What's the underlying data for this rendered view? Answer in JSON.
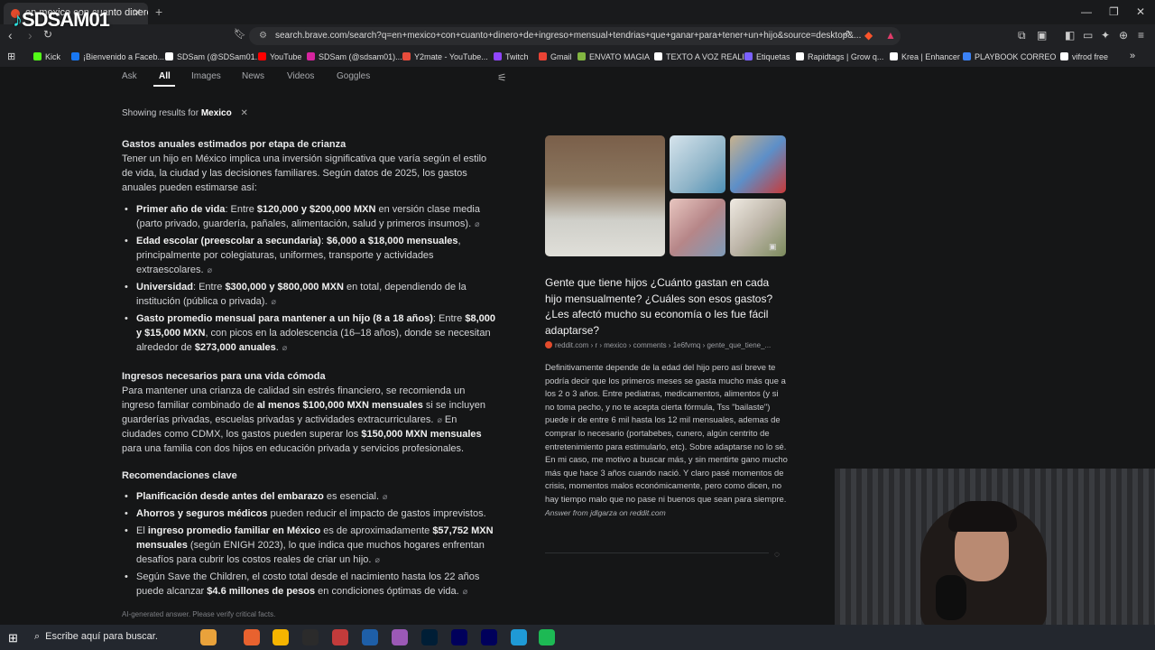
{
  "browser": {
    "tab_title": "en mexico con cuanto dinero de",
    "url": "search.brave.com/search?q=en+mexico+con+cuanto+dinero+de+ingreso+mensual+tendrias+que+ganar+para+tener+un+hijo&source=desktop&...",
    "new_tab": "+",
    "close": "✕"
  },
  "overlay_logo": {
    "text": "SDSAM01",
    "mark": "♪"
  },
  "bookmarks": [
    {
      "label": "Kick",
      "color": "#53fc18"
    },
    {
      "label": "¡Bienvenido a Faceb...",
      "color": "#1877f2"
    },
    {
      "label": "SDSam (@SDSam01...",
      "color": "#ffffff"
    },
    {
      "label": "YouTube",
      "color": "#ff0000"
    },
    {
      "label": "SDSam (@sdsam01)...",
      "color": "#d6249f"
    },
    {
      "label": "Y2mate - YouTube...",
      "color": "#e74c3c"
    },
    {
      "label": "Twitch",
      "color": "#9146ff"
    },
    {
      "label": "Gmail",
      "color": "#ea4335"
    },
    {
      "label": "ENVATO MAGIA",
      "color": "#82b541"
    },
    {
      "label": "TEXTO A VOZ REALI...",
      "color": "#ffffff"
    },
    {
      "label": "Etiquetas",
      "color": "#7b61ff"
    },
    {
      "label": "Rapidtags | Grow q...",
      "color": "#ffffff"
    },
    {
      "label": "Krea | Enhancer",
      "color": "#ffffff"
    },
    {
      "label": "PLAYBOOK CORREO",
      "color": "#3b82f6"
    },
    {
      "label": "vifrod free",
      "color": "#ffffff"
    }
  ],
  "search_tabs": [
    "Ask",
    "All",
    "Images",
    "News",
    "Videos",
    "Goggles"
  ],
  "active_tab": "All",
  "showing": {
    "prefix": "Showing results for",
    "location": "Mexico"
  },
  "answer": {
    "s1_title": "Gastos anuales estimados por etapa de crianza",
    "s1_intro": "Tener un hijo en México implica una inversión significativa que varía según el estilo de vida, la ciudad y las decisiones familiares. Según datos de 2025, los gastos anuales pueden estimarse así:",
    "b1_bold": "Primer año de vida",
    "b1_mid": ": Entre ",
    "b1_bold2": "$120,000 y $200,000 MXN",
    "b1_rest": " en versión clase media (parto privado, guardería, pañales, alimentación, salud y primeros insumos).",
    "b2_bold": "Edad escolar (preescolar a secundaria)",
    "b2_mid": ": ",
    "b2_bold2": "$6,000 a $18,000 mensuales",
    "b2_rest": ", principalmente por colegiaturas, uniformes, transporte y actividades extraescolares.",
    "b3_bold": "Universidad",
    "b3_mid": ": Entre ",
    "b3_bold2": "$300,000 y $800,000 MXN",
    "b3_rest": " en total, dependiendo de la institución (pública o privada).",
    "b4_bold": "Gasto promedio mensual para mantener a un hijo (8 a 18 años)",
    "b4_mid": ": Entre ",
    "b4_bold2": "$8,000 y $15,000 MXN",
    "b4_rest": ", con picos en la adolescencia (16–18 años), donde se necesitan alrededor de ",
    "b4_bold3": "$273,000 anuales",
    "b4_end": ".",
    "s2_title": "Ingresos necesarios para una vida cómoda",
    "s2_p1": "Para mantener una crianza de calidad sin estrés financiero, se recomienda un ingreso familiar combinado de ",
    "s2_b1": "al menos $100,000 MXN mensuales",
    "s2_p2": " si se incluyen guarderías privadas, escuelas privadas y actividades extracurriculares.",
    "s2_p3": " En ciudades como CDMX, los gastos pueden superar los ",
    "s2_b2": "$150,000 MXN mensuales",
    "s2_p4": " para una familia con dos hijos en educación privada y servicios profesionales.",
    "s3_title": "Recomendaciones clave",
    "r1_bold": "Planificación desde antes del embarazo",
    "r1_rest": " es esencial.",
    "r2_bold": "Ahorros y seguros médicos",
    "r2_rest": " pueden reducir el impacto de gastos imprevistos.",
    "r3_pre": "El ",
    "r3_bold": "ingreso promedio familiar en México",
    "r3_mid": " es de aproximadamente ",
    "r3_bold2": "$57,752 MXN mensuales",
    "r3_rest": " (según ENIGH 2023), lo que indica que muchos hogares enfrentan desafíos para cubrir los costos reales de criar un hijo.",
    "r4_pre": "Según Save the Children, el costo total desde el nacimiento hasta los 22 años puede alcanzar ",
    "r4_bold": "$4.6 millones de pesos",
    "r4_rest": " en condiciones óptimas de vida.",
    "link_icon": "⌀",
    "disclaimer": "AI-generated answer. Please verify critical facts."
  },
  "reddit": {
    "title": "Gente que tiene hijos ¿Cuánto gastan en cada hijo mensualmente? ¿Cuáles son esos gastos? ¿Les afectó mucho su economía o les fue fácil adaptarse?",
    "source": "reddit.com › r › mexico › comments › 1e6fvmq › gente_que_tiene_...",
    "body": "Definitivamente depende de la edad del hijo pero así breve te podría decir que los primeros meses se gasta mucho más que a los 2 o 3 años. Entre pediatras, medicamentos, alimentos (y si no toma pecho, y no te acepta cierta fórmula, Tss \"bailaste\") puede ir de entre 6 mil hasta los 12 mil mensuales, ademas de comprar lo necesario (portabebes, cunero, algún centrito de entretenimiento para estimularlo, etc). Sobre adaptarse no lo sé. En mi caso, me motivo a buscar más, y sin mentirte gano mucho más que hace 3 años cuando nació. Y claro pasé momentos de crisis, momentos malos económicamente, pero como dicen, no hay tiempo malo que no pase ni buenos que sean para siempre.",
    "attribution": "Answer from jdlgarza on reddit.com"
  },
  "taskbar": {
    "search_placeholder": "Escribe aquí para buscar.",
    "apps": [
      "#e9a23b",
      "#e8622f",
      "#f5b400",
      "#2b2b2b",
      "#c23b3b",
      "#1e5fa8",
      "#9b59b6",
      "#001e36",
      "#00005b",
      "#00005b",
      "#1f9ad6",
      "#1db954",
      "#ff8b3d"
    ]
  }
}
